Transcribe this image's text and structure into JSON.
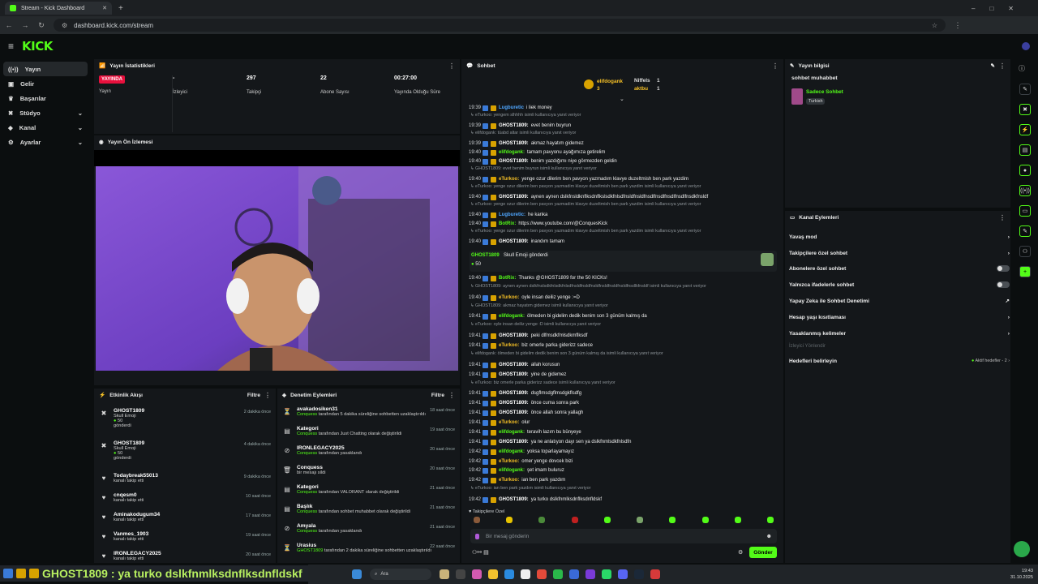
{
  "browser": {
    "tab_title": "Stream - Kick Dashboard",
    "url": "dashboard.kick.com/stream"
  },
  "sidebar": {
    "items": [
      {
        "label": "Yayın",
        "icon": "live-icon",
        "active": true
      },
      {
        "label": "Gelir",
        "icon": "wallet-icon"
      },
      {
        "label": "Başarılar",
        "icon": "trophy-icon"
      },
      {
        "label": "Stüdyo",
        "icon": "studio-icon",
        "chevron": true
      },
      {
        "label": "Kanal",
        "icon": "channel-icon",
        "chevron": true
      },
      {
        "label": "Ayarlar",
        "icon": "settings-icon",
        "chevron": true
      }
    ]
  },
  "stats": {
    "title": "Yayın İstatistikleri",
    "live_badge": "YAYINDA",
    "live_label": "Yayın",
    "viewers_value": "-",
    "viewers_label": "İzleyici",
    "followers_value": "297",
    "followers_label": "Takipçi",
    "subs_value": "22",
    "subs_label": "Abone Sayısı",
    "duration_value": "00:27:00",
    "duration_label": "Yayında Olduğu Süre"
  },
  "preview": {
    "title": "Yayın Ön İzlemesi"
  },
  "activity": {
    "title": "Etkinlik Akışı",
    "filter": "Filtre",
    "items": [
      {
        "name": "GHOST1809",
        "l1": "Skull Emoji",
        "l2": "50",
        "l3": "gönderdi",
        "time": "2 dakika önce",
        "icon": "gift"
      },
      {
        "name": "GHOST1809",
        "l1": "Skull Emoji",
        "l2": "50",
        "l3": "gönderdi",
        "time": "4 dakika önce",
        "icon": "gift"
      },
      {
        "name": "Todaybreak55013",
        "l1": "kanalı takip etti",
        "time": "9 dakika önce",
        "icon": "heart"
      },
      {
        "name": "cnqesm0",
        "l1": "kanalı takip etti",
        "time": "10 saat önce",
        "icon": "heart"
      },
      {
        "name": "Aminakodugum34",
        "l1": "kanalı takip etti",
        "time": "17 saat önce",
        "icon": "heart"
      },
      {
        "name": "Vanmes_1903",
        "l1": "kanalı takip etti",
        "time": "19 saat önce",
        "icon": "heart"
      },
      {
        "name": "IRONLEGACY2025",
        "l1": "kanalı takip etti",
        "time": "20 saat önce",
        "icon": "heart"
      }
    ]
  },
  "moderation": {
    "title": "Denetim Eylemleri",
    "filter": "Filtre",
    "items": [
      {
        "name": "avakadosiken31",
        "actor": "Conquess",
        "text": "tarafından 5 dakika süreliğine sohbetten uzaklaştırıldı",
        "time": "18 saat önce"
      },
      {
        "name": "Kategori",
        "actor": "Conquess",
        "text": "tarafından Just Chatting olarak değiştirildi",
        "time": "19 saat önce"
      },
      {
        "name": "IRONLEGACY2025",
        "actor": "Conquess",
        "text": "tarafından yasaklandı",
        "time": "20 saat önce"
      },
      {
        "name": "Conquess",
        "actor": "",
        "text": "bir mesajı sildi",
        "time": "20 saat önce"
      },
      {
        "name": "Kategori",
        "actor": "Conquess",
        "text": "tarafından VALORANT olarak değiştirildi",
        "time": "21 saat önce"
      },
      {
        "name": "Başlık",
        "actor": "Conquess",
        "text": "tarafından sohbet muhabbet olarak değiştirildi",
        "time": "21 saat önce"
      },
      {
        "name": "Amyala",
        "actor": "Conquess",
        "text": "tarafından yasaklandı",
        "time": "21 saat önce"
      },
      {
        "name": "Urasius",
        "actor": "GHOST1809",
        "text": "tarafından 2 dakika süreliğine sohbetten uzaklaştırıldı",
        "time": "22 saat önce"
      }
    ]
  },
  "chat": {
    "title": "Sohbet",
    "pinned": {
      "user1": "elifdogank",
      "user1_count": "3",
      "user2": "Niffels",
      "user2_count": "1",
      "user3": "aktbu",
      "user3_count": "1"
    },
    "lines": [
      {
        "type": "msg",
        "ts": "19:39",
        "user": "Lugburetic",
        "color": "#4fa7ff",
        "text": "i liek money"
      },
      {
        "type": "reply",
        "text": "eTurkoo: yengem slhhhh isimli kullanıcıya yanıt veriyor"
      },
      {
        "type": "msg",
        "ts": "19:39",
        "user": "GHOST1809:",
        "color": "#ffffff",
        "text": "evet benim buyrun"
      },
      {
        "type": "reply",
        "text": "elifdogank: tüabd altar isimli kullanıcıya yanıt veriyor"
      },
      {
        "type": "msg",
        "ts": "19:39",
        "user": "GHOST1809:",
        "color": "#ffffff",
        "text": "akmaz hayatım gidemez"
      },
      {
        "type": "msg",
        "ts": "19:40",
        "user": "elifdogank:",
        "color": "#53fc18",
        "text": "tamam pavyonu ayağımıza getirelim"
      },
      {
        "type": "msg",
        "ts": "19:40",
        "user": "GHOST1809:",
        "color": "#ffffff",
        "text": "benim yazdığımı niye görmezden geldin"
      },
      {
        "type": "reply",
        "text": "GHOST1809: evet benim buyrun isimli kullanıcıya yanıt veriyor"
      },
      {
        "type": "msg",
        "ts": "19:40",
        "user": "eTurkoo:",
        "color": "#f6c026",
        "text": "yenge ozur dilerim ben pavyon yazmadım klavye duzeltmish ben park yazdim"
      },
      {
        "type": "reply",
        "text": "eTurkoo: yenge ozur dilerim ben pavyon yazmadim klavye duzeltmish ben park yazdim isimli kullanıcıya yanıt veriyor"
      },
      {
        "type": "msg",
        "ts": "19:40",
        "user": "GHOST1809:",
        "color": "#ffffff",
        "text": "aynen aynen dslkfnsldknflksdnflkslsdkfnlsdfnsldfnsldfnsdlfnsdlfnsdlfnsdlfnsdkfnsldf"
      },
      {
        "type": "reply",
        "text": "eTurkoo: yenge ozur dilerim ben pavyon yazmadim klavye duzeltmish ben park yazdim isimli kullanıcıya yanıt veriyor"
      },
      {
        "type": "msg",
        "ts": "19:40",
        "user": "Lugburetic:",
        "color": "#4fa7ff",
        "text": "he kanka"
      },
      {
        "type": "msg",
        "ts": "19:40",
        "user": "BotRix:",
        "color": "#53fc18",
        "text": "https://www.youtube.com/@ConquesKick"
      },
      {
        "type": "reply",
        "text": "eTurkoo: yenge ozur dilerim ben pavyon yazmadim klavye duzeltmish ben park yazdim isimli kullanıcıya yanıt veriyor"
      },
      {
        "type": "msg",
        "ts": "19:40",
        "user": "GHOST1809:",
        "color": "#ffffff",
        "text": "inandım tamam"
      }
    ],
    "gift": {
      "user": "GHOST1809",
      "text": "Skull Emoji gönderdi",
      "amount": "50"
    },
    "lines2": [
      {
        "type": "msg",
        "ts": "19:40",
        "user": "BotRix:",
        "color": "#53fc18",
        "text": "Thanks @GHOST1809 for the 50 KICKs!"
      },
      {
        "type": "reply",
        "text": "GHOST1809: aynen aynen dslkfnslsdkfnlsdkfnlsdfnsldfnsldfnsldfnsldfnsldfnsldfnsdlkfnsldf isimli kullanıcıya yanıt veriyor"
      },
      {
        "type": "msg",
        "ts": "19:40",
        "user": "eTurkoo:",
        "color": "#f6c026",
        "text": "oyle insan deiliz yenge :=D"
      },
      {
        "type": "reply",
        "text": "GHOST1809: akmaz hayatım gidemez isimli kullanıcıya yanıt veriyor"
      },
      {
        "type": "msg",
        "ts": "19:41",
        "user": "elifdogank:",
        "color": "#53fc18",
        "text": "ölmeden bi gidelim dedik benim son 3 günüm kalmış da"
      },
      {
        "type": "reply",
        "text": "eTurkoo: oyle insan deiliz yenge :D isimli kullanıcıya yanıt veriyor"
      },
      {
        "type": "msg",
        "ts": "19:41",
        "user": "GHOST1809:",
        "color": "#ffffff",
        "text": "peki dlfmsdkfmlsdkmflksdf"
      },
      {
        "type": "msg",
        "ts": "19:41",
        "user": "eTurkoo:",
        "color": "#f6c026",
        "text": "biz omerle parka giderizz sadece"
      },
      {
        "type": "reply",
        "text": "elifdogank: ölmeden bi gidelim dedik benim son 3 günüm kalmış da isimli kullanıcıya yanıt veriyor"
      },
      {
        "type": "msg",
        "ts": "19:41",
        "user": "GHOST1809:",
        "color": "#ffffff",
        "text": "allah korusun"
      },
      {
        "type": "msg",
        "ts": "19:41",
        "user": "GHOST1809:",
        "color": "#ffffff",
        "text": "yine de gidemez"
      },
      {
        "type": "reply",
        "text": "eTurkoo: biz omerle parka giderizz sadece isimli kullanıcıya yanıt veriyor"
      },
      {
        "type": "msg",
        "ts": "19:41",
        "user": "GHOST1809:",
        "color": "#ffffff",
        "text": "dsgflmsdgflmsdgkflsdfg"
      },
      {
        "type": "msg",
        "ts": "19:41",
        "user": "GHOST1809:",
        "color": "#ffffff",
        "text": "önce cuma sonra park"
      },
      {
        "type": "msg",
        "ts": "19:41",
        "user": "GHOST1809:",
        "color": "#ffffff",
        "text": "önce allah sonra yallagh"
      },
      {
        "type": "msg",
        "ts": "19:41",
        "user": "eTurkoo:",
        "color": "#f6c026",
        "text": "olur"
      },
      {
        "type": "msg",
        "ts": "19:41",
        "user": "elifdogank:",
        "color": "#53fc18",
        "text": "teravih lazım bu bünyeye"
      },
      {
        "type": "msg",
        "ts": "19:41",
        "user": "GHOST1809:",
        "color": "#ffffff",
        "text": "ya ne anlatıyon dayı sen ya dslkfnmlsdkfnlsdfn"
      },
      {
        "type": "msg",
        "ts": "19:42",
        "user": "elifdogank:",
        "color": "#53fc18",
        "text": "yoksa toparlayamayız"
      },
      {
        "type": "msg",
        "ts": "19:42",
        "user": "eTurkoo:",
        "color": "#f6c026",
        "text": "omer yenge dovcek bizi"
      },
      {
        "type": "msg",
        "ts": "19:42",
        "user": "elifdogank:",
        "color": "#53fc18",
        "text": "şet imam buluruz"
      },
      {
        "type": "msg",
        "ts": "19:42",
        "user": "eTurkoo:",
        "color": "#f6c026",
        "text": "ian ben park yazdım"
      },
      {
        "type": "reply",
        "text": "eTurkoo: ian ben park yazdım isimli kullanıcıya yanıt veriyor"
      },
      {
        "type": "msg",
        "ts": "19:42",
        "user": "GHOST1809:",
        "color": "#ffffff",
        "text": "ya turko dslkfnmlksdnflksdnfldskf"
      }
    ],
    "mode_label": "Takipçilere Özel",
    "input_placeholder": "Bir mesaj gönderin",
    "send_label": "Gönder"
  },
  "stream_info": {
    "title": "Yayın bilgisi",
    "stream_title": "sohbet muhabbet",
    "category": "Sadece Sohbet",
    "tag": "Turkish"
  },
  "actions": {
    "title": "Kanal Eylemleri",
    "items": [
      {
        "label": "Yavaş mod",
        "ctrl": "chevron"
      },
      {
        "label": "Takipçilere özel sohbet",
        "ctrl": "chevron"
      },
      {
        "label": "Abonelere özel sohbet",
        "ctrl": "toggle"
      },
      {
        "label": "Yalnızca ifadelerle sohbet",
        "ctrl": "toggle"
      },
      {
        "label": "Yapay Zeka ile Sohbet Denetimi",
        "ctrl": "ext"
      },
      {
        "label": "Hesap yaşı kısıtlaması",
        "ctrl": "chevron"
      },
      {
        "label": "Yasaklanmış kelimeler",
        "ctrl": "chevron"
      }
    ],
    "viewer_mode": "İzleyici Yönlendir",
    "goals_label": "Hedefleri belirleyin",
    "goals_status": "Aktif hedefler - 2"
  },
  "overlay_text": "GHOST1809 : ya turko dslkfnmlksdnflksdnfldskf",
  "taskbar": {
    "search": "Ara",
    "time": "19:43",
    "date": "31.10.2025"
  },
  "colors": {
    "accent": "#53fc18",
    "live": "#e8103d"
  }
}
